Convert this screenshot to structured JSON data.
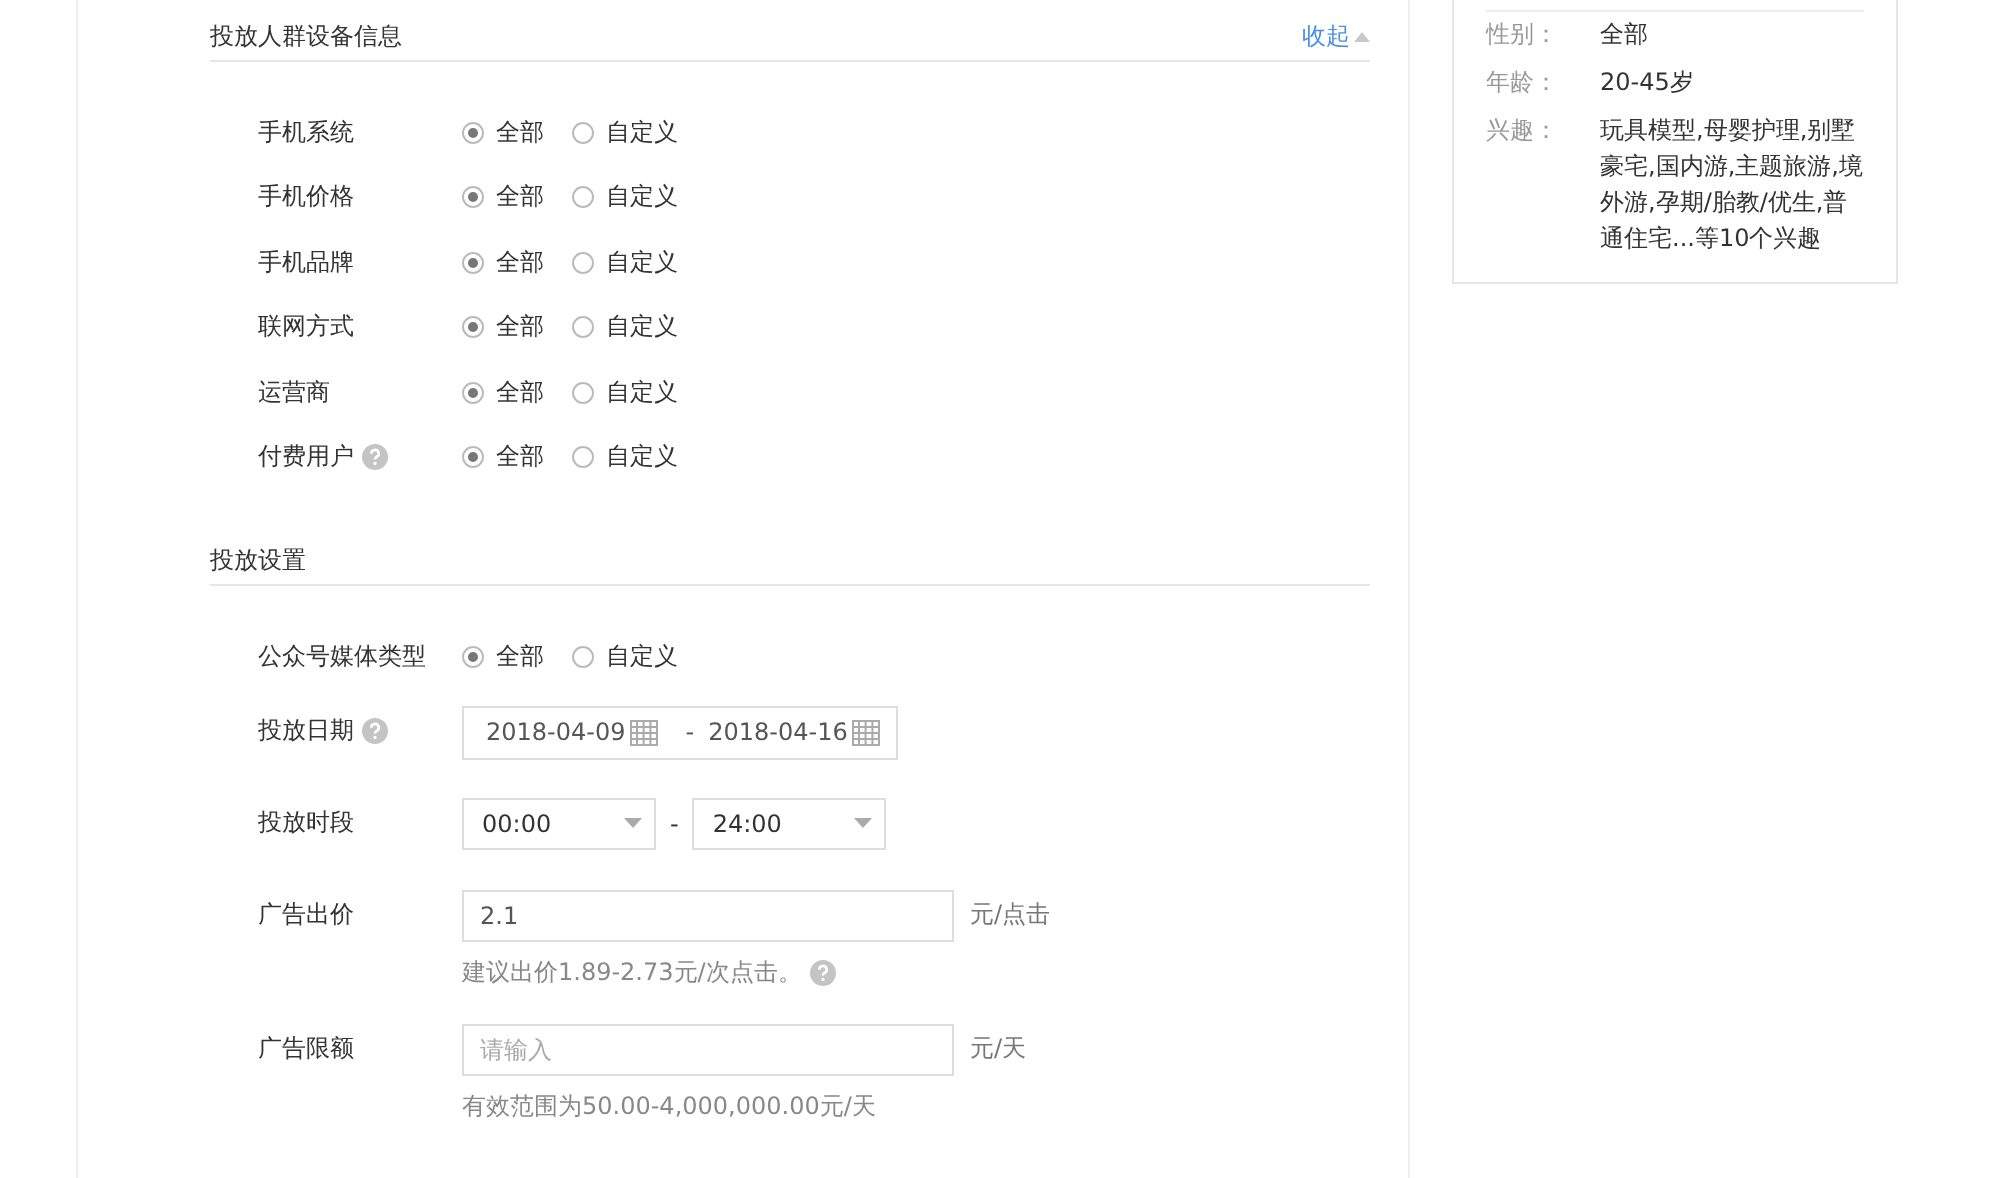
{
  "sections": [
    {
      "title": "投放人群设备信息",
      "toggle": {
        "label": "收起",
        "expanded": true
      },
      "rows": [
        {
          "kind": "radio",
          "label": "手机系统",
          "help": false,
          "options": [
            {
              "label": "全部",
              "selected": true
            },
            {
              "label": "自定义",
              "selected": false
            }
          ]
        },
        {
          "kind": "radio",
          "label": "手机价格",
          "help": false,
          "options": [
            {
              "label": "全部",
              "selected": true
            },
            {
              "label": "自定义",
              "selected": false
            }
          ]
        },
        {
          "kind": "radio",
          "label": "手机品牌",
          "help": false,
          "options": [
            {
              "label": "全部",
              "selected": true
            },
            {
              "label": "自定义",
              "selected": false
            }
          ]
        },
        {
          "kind": "radio",
          "label": "联网方式",
          "help": false,
          "options": [
            {
              "label": "全部",
              "selected": true
            },
            {
              "label": "自定义",
              "selected": false
            }
          ]
        },
        {
          "kind": "radio",
          "label": "运营商",
          "help": false,
          "options": [
            {
              "label": "全部",
              "selected": true
            },
            {
              "label": "自定义",
              "selected": false
            }
          ]
        },
        {
          "kind": "radio",
          "label": "付费用户",
          "help": true,
          "options": [
            {
              "label": "全部",
              "selected": true
            },
            {
              "label": "自定义",
              "selected": false
            }
          ]
        }
      ]
    },
    {
      "title": "投放设置",
      "rows": [
        {
          "kind": "radio",
          "label": "公众号媒体类型",
          "help": false,
          "options": [
            {
              "label": "全部",
              "selected": true
            },
            {
              "label": "自定义",
              "selected": false
            }
          ]
        },
        {
          "kind": "date_range",
          "label": "投放日期",
          "help": true,
          "start": "2018-04-09",
          "separator": "-",
          "end": "2018-04-16"
        },
        {
          "kind": "time_range",
          "label": "投放时段",
          "help": false,
          "start": "00:00",
          "separator": "-",
          "end": "24:00"
        },
        {
          "kind": "input",
          "label": "广告出价",
          "help": false,
          "value": "2.1",
          "unit": "元/点击",
          "hint": "建议出价1.89-2.73元/次点击。",
          "hint_help": true
        },
        {
          "kind": "input",
          "label": "广告限额",
          "help": false,
          "placeholder": "请输入",
          "unit": "元/天",
          "hint": "有效范围为50.00-4,000,000.00元/天",
          "hint_help": false
        }
      ]
    }
  ],
  "summary": {
    "rows": [
      {
        "label": "性别：",
        "value": "全部"
      },
      {
        "label": "年龄：",
        "value": "20-45岁"
      },
      {
        "label": "兴趣：",
        "value": "玩具模型,母婴护理,别墅豪宅,国内游,主题旅游,境外游,孕期/胎教/优生,普通住宅...等10个兴趣"
      }
    ]
  }
}
